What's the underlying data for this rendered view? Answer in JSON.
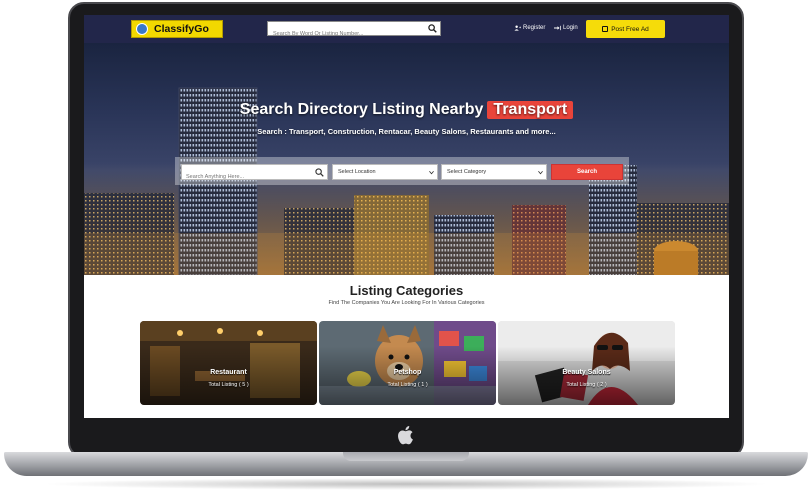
{
  "header": {
    "logo_text": "ClassifyGo",
    "search_placeholder": "Search By Word Or Listing Number...",
    "register_label": "Register",
    "login_label": "Login",
    "post_ad_label": "Post Free Ad"
  },
  "hero": {
    "title": "Search Directory Listing Nearby",
    "highlight": "Transport",
    "subtitle": "Search : Transport, Construction, Rentacar, Beauty Salons, Restaurants and more...",
    "search_placeholder": "Search Anything Here...",
    "location_select": "Select Location",
    "category_select": "Select Category",
    "search_button": "Search"
  },
  "categories": {
    "title": "Listing Categories",
    "subtitle": "Find The Companies You Are Looking For In Various Categories",
    "items": [
      {
        "name": "Restaurant",
        "count": "Total Listing ( 5 )"
      },
      {
        "name": "Petshop",
        "count": "Total Listing ( 1 )"
      },
      {
        "name": "Beauty Salons",
        "count": "Total Listing ( 2 )"
      }
    ]
  },
  "colors": {
    "nav_bg": "#22264a",
    "brand_yellow": "#f5dc0a",
    "accent_red": "#e9443a"
  }
}
